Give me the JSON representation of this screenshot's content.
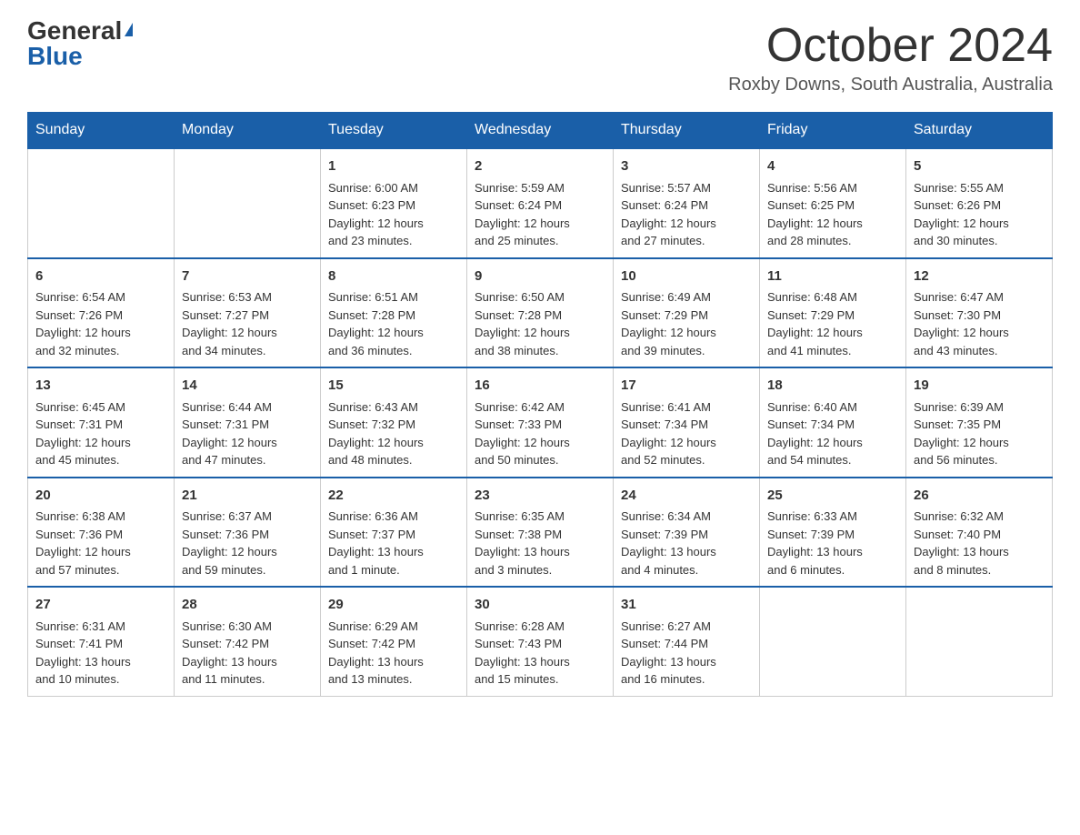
{
  "logo": {
    "general": "General",
    "blue": "Blue"
  },
  "title": "October 2024",
  "location": "Roxby Downs, South Australia, Australia",
  "days_of_week": [
    "Sunday",
    "Monday",
    "Tuesday",
    "Wednesday",
    "Thursday",
    "Friday",
    "Saturday"
  ],
  "weeks": [
    [
      {
        "day": "",
        "info": ""
      },
      {
        "day": "",
        "info": ""
      },
      {
        "day": "1",
        "info": "Sunrise: 6:00 AM\nSunset: 6:23 PM\nDaylight: 12 hours\nand 23 minutes."
      },
      {
        "day": "2",
        "info": "Sunrise: 5:59 AM\nSunset: 6:24 PM\nDaylight: 12 hours\nand 25 minutes."
      },
      {
        "day": "3",
        "info": "Sunrise: 5:57 AM\nSunset: 6:24 PM\nDaylight: 12 hours\nand 27 minutes."
      },
      {
        "day": "4",
        "info": "Sunrise: 5:56 AM\nSunset: 6:25 PM\nDaylight: 12 hours\nand 28 minutes."
      },
      {
        "day": "5",
        "info": "Sunrise: 5:55 AM\nSunset: 6:26 PM\nDaylight: 12 hours\nand 30 minutes."
      }
    ],
    [
      {
        "day": "6",
        "info": "Sunrise: 6:54 AM\nSunset: 7:26 PM\nDaylight: 12 hours\nand 32 minutes."
      },
      {
        "day": "7",
        "info": "Sunrise: 6:53 AM\nSunset: 7:27 PM\nDaylight: 12 hours\nand 34 minutes."
      },
      {
        "day": "8",
        "info": "Sunrise: 6:51 AM\nSunset: 7:28 PM\nDaylight: 12 hours\nand 36 minutes."
      },
      {
        "day": "9",
        "info": "Sunrise: 6:50 AM\nSunset: 7:28 PM\nDaylight: 12 hours\nand 38 minutes."
      },
      {
        "day": "10",
        "info": "Sunrise: 6:49 AM\nSunset: 7:29 PM\nDaylight: 12 hours\nand 39 minutes."
      },
      {
        "day": "11",
        "info": "Sunrise: 6:48 AM\nSunset: 7:29 PM\nDaylight: 12 hours\nand 41 minutes."
      },
      {
        "day": "12",
        "info": "Sunrise: 6:47 AM\nSunset: 7:30 PM\nDaylight: 12 hours\nand 43 minutes."
      }
    ],
    [
      {
        "day": "13",
        "info": "Sunrise: 6:45 AM\nSunset: 7:31 PM\nDaylight: 12 hours\nand 45 minutes."
      },
      {
        "day": "14",
        "info": "Sunrise: 6:44 AM\nSunset: 7:31 PM\nDaylight: 12 hours\nand 47 minutes."
      },
      {
        "day": "15",
        "info": "Sunrise: 6:43 AM\nSunset: 7:32 PM\nDaylight: 12 hours\nand 48 minutes."
      },
      {
        "day": "16",
        "info": "Sunrise: 6:42 AM\nSunset: 7:33 PM\nDaylight: 12 hours\nand 50 minutes."
      },
      {
        "day": "17",
        "info": "Sunrise: 6:41 AM\nSunset: 7:34 PM\nDaylight: 12 hours\nand 52 minutes."
      },
      {
        "day": "18",
        "info": "Sunrise: 6:40 AM\nSunset: 7:34 PM\nDaylight: 12 hours\nand 54 minutes."
      },
      {
        "day": "19",
        "info": "Sunrise: 6:39 AM\nSunset: 7:35 PM\nDaylight: 12 hours\nand 56 minutes."
      }
    ],
    [
      {
        "day": "20",
        "info": "Sunrise: 6:38 AM\nSunset: 7:36 PM\nDaylight: 12 hours\nand 57 minutes."
      },
      {
        "day": "21",
        "info": "Sunrise: 6:37 AM\nSunset: 7:36 PM\nDaylight: 12 hours\nand 59 minutes."
      },
      {
        "day": "22",
        "info": "Sunrise: 6:36 AM\nSunset: 7:37 PM\nDaylight: 13 hours\nand 1 minute."
      },
      {
        "day": "23",
        "info": "Sunrise: 6:35 AM\nSunset: 7:38 PM\nDaylight: 13 hours\nand 3 minutes."
      },
      {
        "day": "24",
        "info": "Sunrise: 6:34 AM\nSunset: 7:39 PM\nDaylight: 13 hours\nand 4 minutes."
      },
      {
        "day": "25",
        "info": "Sunrise: 6:33 AM\nSunset: 7:39 PM\nDaylight: 13 hours\nand 6 minutes."
      },
      {
        "day": "26",
        "info": "Sunrise: 6:32 AM\nSunset: 7:40 PM\nDaylight: 13 hours\nand 8 minutes."
      }
    ],
    [
      {
        "day": "27",
        "info": "Sunrise: 6:31 AM\nSunset: 7:41 PM\nDaylight: 13 hours\nand 10 minutes."
      },
      {
        "day": "28",
        "info": "Sunrise: 6:30 AM\nSunset: 7:42 PM\nDaylight: 13 hours\nand 11 minutes."
      },
      {
        "day": "29",
        "info": "Sunrise: 6:29 AM\nSunset: 7:42 PM\nDaylight: 13 hours\nand 13 minutes."
      },
      {
        "day": "30",
        "info": "Sunrise: 6:28 AM\nSunset: 7:43 PM\nDaylight: 13 hours\nand 15 minutes."
      },
      {
        "day": "31",
        "info": "Sunrise: 6:27 AM\nSunset: 7:44 PM\nDaylight: 13 hours\nand 16 minutes."
      },
      {
        "day": "",
        "info": ""
      },
      {
        "day": "",
        "info": ""
      }
    ]
  ]
}
